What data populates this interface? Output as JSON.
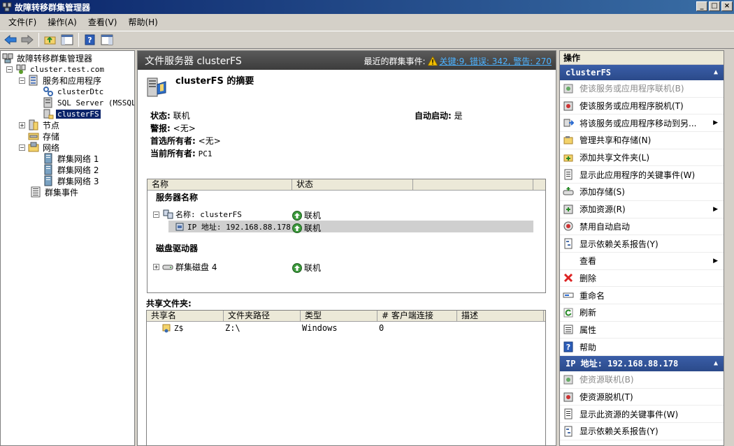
{
  "window": {
    "title": "故障转移群集管理器",
    "btn_min": "_",
    "btn_max": "□",
    "btn_close": "×"
  },
  "menu": [
    "文件(F)",
    "操作(A)",
    "查看(V)",
    "帮助(H)"
  ],
  "tree": {
    "root": "故障转移群集管理器",
    "cluster": "cluster.test.com",
    "services": "服务和应用程序",
    "dtc": "clusterDtc",
    "sql": "SQL Server (MSSQLS",
    "fs": "clusterFS",
    "nodes": "节点",
    "storage": "存储",
    "networks": "网络",
    "net1": "群集网络 1",
    "net2": "群集网络 2",
    "net3": "群集网络 3",
    "events": "群集事件"
  },
  "center": {
    "header_title": "文件服务器 clusterFS",
    "events_label": "最近的群集事件:",
    "events_link": "关键:9, 错误: 342, 警告: 270",
    "summary_title": "clusterFS 的摘要",
    "status_label": "状态:",
    "status_value": "联机",
    "autostart_label": "自动启动:",
    "autostart_value": "是",
    "alert_label": "警报:",
    "alert_value": "<无>",
    "preferred_label": "首选所有者:",
    "preferred_value": "<无>",
    "owner_label": "当前所有者:",
    "owner_value": "PC1",
    "grid1": {
      "col_name": "名称",
      "col_status": "状态",
      "group_server": "服务器名称",
      "name_row": "名称: clusterFS",
      "name_status": "联机",
      "ip_row": "IP 地址: 192.168.88.178",
      "ip_status": "联机",
      "group_disk": "磁盘驱动器",
      "disk_row": "群集磁盘 4",
      "disk_status": "联机"
    },
    "shares_label": "共享文件夹:",
    "grid2": {
      "cols": [
        "共享名",
        "文件夹路径",
        "类型",
        "# 客户端连接",
        "描述"
      ],
      "row": [
        "Z$",
        "Z:\\",
        "Windows",
        "0",
        ""
      ]
    }
  },
  "actions": {
    "header": "操作",
    "sec1": "clusterFS",
    "items1": [
      {
        "label": "使该服务或应用程序联机(B)",
        "disabled": true
      },
      {
        "label": "使该服务或应用程序脱机(T)"
      },
      {
        "label": "将该服务或应用程序移动到另...",
        "sub": true
      },
      {
        "label": "管理共享和存储(N)"
      },
      {
        "label": "添加共享文件夹(L)"
      },
      {
        "label": "显示此应用程序的关键事件(W)"
      },
      {
        "label": "添加存储(S)"
      },
      {
        "label": "添加资源(R)",
        "sub": true
      },
      {
        "label": "禁用自动启动"
      },
      {
        "label": "显示依赖关系报告(Y)"
      },
      {
        "label": "查看",
        "sub": true
      },
      {
        "label": "删除"
      },
      {
        "label": "重命名"
      },
      {
        "label": "刷新"
      },
      {
        "label": "属性"
      },
      {
        "label": "帮助"
      }
    ],
    "sec2": "IP 地址: 192.168.88.178",
    "items2": [
      {
        "label": "使资源联机(B)",
        "disabled": true
      },
      {
        "label": "使资源脱机(T)"
      },
      {
        "label": "显示此资源的关键事件(W)"
      },
      {
        "label": "显示依赖关系报告(Y)"
      }
    ]
  }
}
